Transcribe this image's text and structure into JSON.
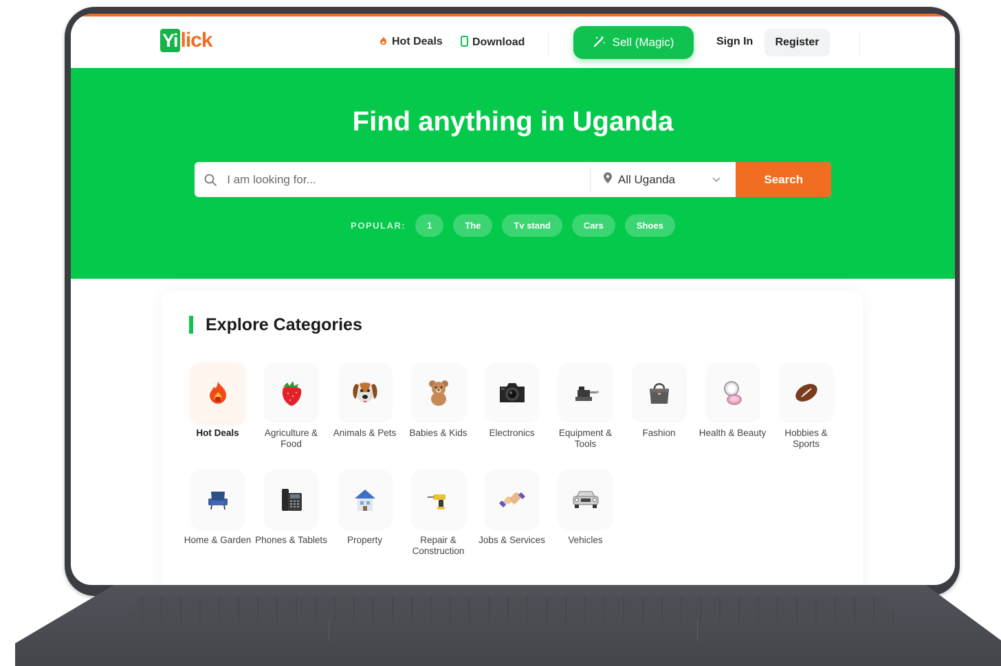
{
  "header": {
    "logo_mark": "Yi",
    "logo_text": "lick",
    "hot_deals": "Hot Deals",
    "download": "Download",
    "sell": "Sell (Magic)",
    "sign_in": "Sign In",
    "register": "Register"
  },
  "hero": {
    "title": "Find anything in Uganda",
    "search_placeholder": "I am looking for...",
    "location": "All Uganda",
    "search_button": "Search",
    "popular_label": "POPULAR:",
    "popular": [
      "1",
      "The",
      "Tv stand",
      "Cars",
      "Shoes"
    ]
  },
  "categories": {
    "title": "Explore Categories",
    "items": [
      {
        "label": "Hot Deals",
        "icon": "flame-icon"
      },
      {
        "label": "Agriculture & Food",
        "icon": "strawberry-icon"
      },
      {
        "label": "Animals & Pets",
        "icon": "dog-icon"
      },
      {
        "label": "Babies & Kids",
        "icon": "teddy-bear-icon"
      },
      {
        "label": "Electronics",
        "icon": "camera-icon"
      },
      {
        "label": "Equipment & Tools",
        "icon": "vise-icon"
      },
      {
        "label": "Fashion",
        "icon": "handbag-icon"
      },
      {
        "label": "Health & Beauty",
        "icon": "compact-mirror-icon"
      },
      {
        "label": "Hobbies & Sports",
        "icon": "football-icon"
      },
      {
        "label": "Home & Garden",
        "icon": "armchair-icon"
      },
      {
        "label": "Phones & Tablets",
        "icon": "desk-phone-icon"
      },
      {
        "label": "Property",
        "icon": "house-icon"
      },
      {
        "label": "Repair & Construction",
        "icon": "drill-icon"
      },
      {
        "label": "Jobs & Services",
        "icon": "handshake-icon"
      },
      {
        "label": "Vehicles",
        "icon": "car-icon"
      }
    ]
  },
  "colors": {
    "brand_green": "#05c94b",
    "accent_orange": "#f06d22"
  }
}
